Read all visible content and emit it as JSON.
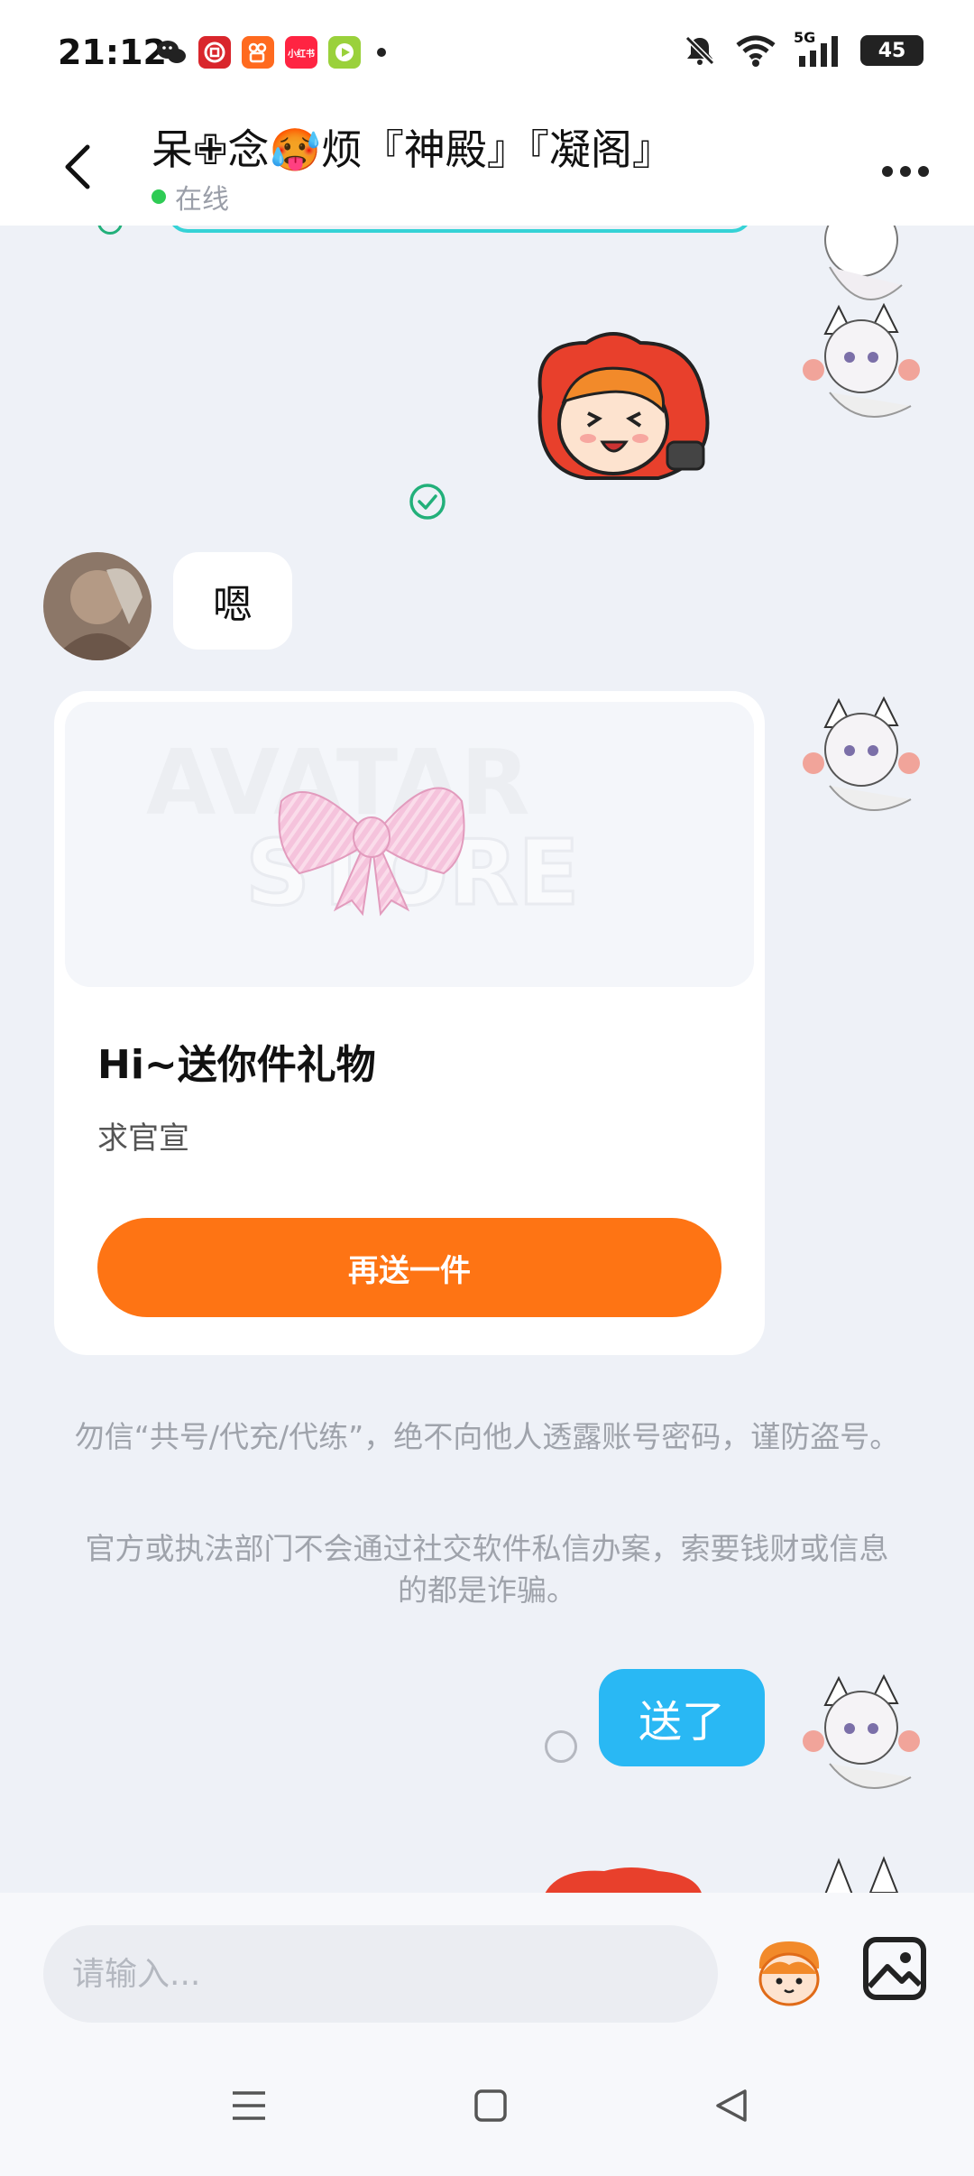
{
  "status_bar": {
    "time": "21:12",
    "battery": "45",
    "network": "5G",
    "app_icons": [
      "wechat-icon",
      "bank-icon",
      "kuaishou-icon",
      "xiaohongshu-icon",
      "video-app-icon"
    ],
    "xiaohongshu_label": "小红书"
  },
  "header": {
    "title": "呆✙念🥵烦『神殿』『凝阁』",
    "status": "在线"
  },
  "messages": {
    "left_text": "嗯",
    "right_text": "送了"
  },
  "gift_card": {
    "watermark_line1": "AVATAR",
    "watermark_line2": "STORE",
    "title": "Hi~送你件礼物",
    "subtitle": "求官宣",
    "button_label": "再送一件"
  },
  "notices": {
    "line1": "勿信“共号/代充/代练”，绝不向他人透露账号密码，谨防盗号。",
    "line2": "官方或执法部门不会通过社交软件私信办案，索要钱财或信息的都是诈骗。"
  },
  "input": {
    "placeholder": "请输入..."
  },
  "colors": {
    "accent_orange": "#fe7414",
    "bubble_blue": "#29b8f4",
    "online_green": "#2ecb54",
    "background": "#eef1f7"
  }
}
